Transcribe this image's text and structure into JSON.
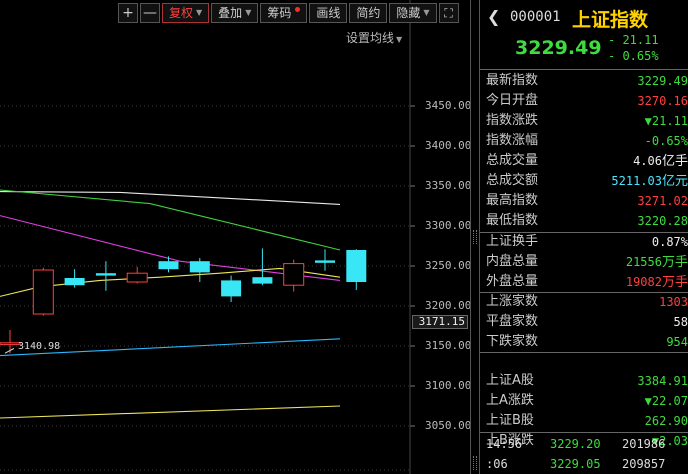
{
  "toolbar": {
    "plus": "+",
    "minus": "—",
    "fuquan": "复权",
    "diejia": "叠加",
    "chouma": "筹码",
    "huaxian": "画线",
    "jianyue": "简约",
    "yincang": "隐藏",
    "fullscreen": "⛶"
  },
  "settings_ma": "设置均线",
  "colors": {
    "up": "#ff4040",
    "down": "#3fdc3f",
    "cyan_candle": "#38e6f5",
    "ma_white": "#e8e8e8",
    "ma_yellow": "#f0e65a",
    "ma_magenta": "#e040e0",
    "ma_green": "#40d040",
    "band_cyan": "#2ab8ff",
    "title_yellow": "#ffd200"
  },
  "chart_data": {
    "type": "candlestick",
    "y_ticks": [
      "3450.00",
      "3400.00",
      "3350.00",
      "3300.00",
      "3250.00",
      "3200.00",
      "3150.00",
      "3100.00",
      "3050.00"
    ],
    "current_price_label": "3171.15",
    "low_marker_label": "3140.98",
    "candles": [
      {
        "open": 3152,
        "close": 3154,
        "high": 3170,
        "low": 3141,
        "color": "up"
      },
      {
        "open": 3190,
        "close": 3245,
        "high": 3248,
        "low": 3188,
        "color": "up"
      },
      {
        "open": 3226,
        "close": 3235,
        "high": 3246,
        "low": 3223,
        "color": "down"
      },
      {
        "open": 3238,
        "close": 3241,
        "high": 3256,
        "low": 3219,
        "color": "down"
      },
      {
        "open": 3230,
        "close": 3241,
        "high": 3249,
        "low": 3228,
        "color": "up"
      },
      {
        "open": 3246,
        "close": 3256,
        "high": 3262,
        "low": 3242,
        "color": "down"
      },
      {
        "open": 3256,
        "close": 3242,
        "high": 3260,
        "low": 3230,
        "color": "down"
      },
      {
        "open": 3232,
        "close": 3212,
        "high": 3238,
        "low": 3205,
        "color": "down"
      },
      {
        "open": 3228,
        "close": 3236,
        "high": 3272,
        "low": 3226,
        "color": "down"
      },
      {
        "open": 3226,
        "close": 3253,
        "high": 3258,
        "low": 3218,
        "color": "up"
      },
      {
        "open": 3254,
        "close": 3257,
        "high": 3271,
        "low": 3244,
        "color": "down"
      },
      {
        "open": 3270,
        "close": 3230,
        "high": 3271,
        "low": 3220,
        "color": "down"
      }
    ],
    "ma_lines": [
      {
        "color": "ma_white",
        "points": [
          [
            0,
            3343
          ],
          [
            120,
            3342
          ],
          [
            340,
            3327
          ]
        ]
      },
      {
        "color": "ma_green",
        "points": [
          [
            0,
            3345
          ],
          [
            150,
            3328
          ],
          [
            340,
            3270
          ]
        ]
      },
      {
        "color": "ma_magenta",
        "points": [
          [
            0,
            3313
          ],
          [
            180,
            3256
          ],
          [
            340,
            3232
          ]
        ]
      },
      {
        "color": "ma_yellow",
        "points": [
          [
            0,
            3212
          ],
          [
            40,
            3224
          ],
          [
            100,
            3232
          ],
          [
            160,
            3236
          ],
          [
            220,
            3241
          ],
          [
            280,
            3247
          ],
          [
            340,
            3236
          ]
        ]
      },
      {
        "color": "band_cyan",
        "points": [
          [
            0,
            3138
          ],
          [
            340,
            3159
          ]
        ]
      },
      {
        "color": "ma_yellow",
        "points": [
          [
            0,
            3060
          ],
          [
            340,
            3075
          ]
        ]
      }
    ]
  },
  "quote": {
    "back_icon": "❮",
    "code": "000001",
    "name": "上证指数",
    "price": "3229.49",
    "change": "- 21.11",
    "change_pct": "- 0.65%"
  },
  "stats": [
    {
      "label": "最新指数",
      "value": "3229.49",
      "unit": "",
      "color": "c-green"
    },
    {
      "label": "今日开盘",
      "value": "3270.16",
      "unit": "",
      "color": "c-red"
    },
    {
      "label": "指数涨跌",
      "value": "▼21.11",
      "unit": "",
      "color": "c-green"
    },
    {
      "label": "指数涨幅",
      "value": "-0.65%",
      "unit": "",
      "color": "c-green"
    },
    {
      "label": "总成交量",
      "value": "4.06",
      "unit": "亿手",
      "color": "c-white"
    },
    {
      "label": "总成交额",
      "value": "5211.03",
      "unit": "亿元",
      "color": "c-cyan"
    },
    {
      "label": "最高指数",
      "value": "3271.02",
      "unit": "",
      "color": "c-red"
    },
    {
      "label": "最低指数",
      "value": "3220.28",
      "unit": "",
      "color": "c-green"
    }
  ],
  "stats2": [
    {
      "label": "上证换手",
      "value": "0.87%",
      "unit": "",
      "color": "c-white"
    },
    {
      "label": "内盘总量",
      "value": "21556",
      "unit": "万手",
      "color": "c-green"
    },
    {
      "label": "外盘总量",
      "value": "19082",
      "unit": "万手",
      "color": "c-red"
    }
  ],
  "stats3": [
    {
      "label": "上涨家数",
      "value": "1303",
      "unit": "",
      "color": "c-red"
    },
    {
      "label": "平盘家数",
      "value": "58",
      "unit": "",
      "color": "c-white"
    },
    {
      "label": "下跌家数",
      "value": "954",
      "unit": "",
      "color": "c-green"
    }
  ],
  "stats4": [
    {
      "label": "上证A股",
      "value": "3384.91",
      "unit": "",
      "color": "c-green"
    },
    {
      "label": "上A涨跌",
      "value": "▼22.07",
      "unit": "",
      "color": "c-green"
    },
    {
      "label": "上证B股",
      "value": "262.90",
      "unit": "",
      "color": "c-green"
    },
    {
      "label": "上B涨跌",
      "value": "▼2.03",
      "unit": "",
      "color": "c-green"
    }
  ],
  "ticks": [
    {
      "time": "14:56",
      "price": "3229.20",
      "vol": "201986"
    },
    {
      "time": ":06",
      "price": "3229.05",
      "vol": "209857"
    }
  ]
}
